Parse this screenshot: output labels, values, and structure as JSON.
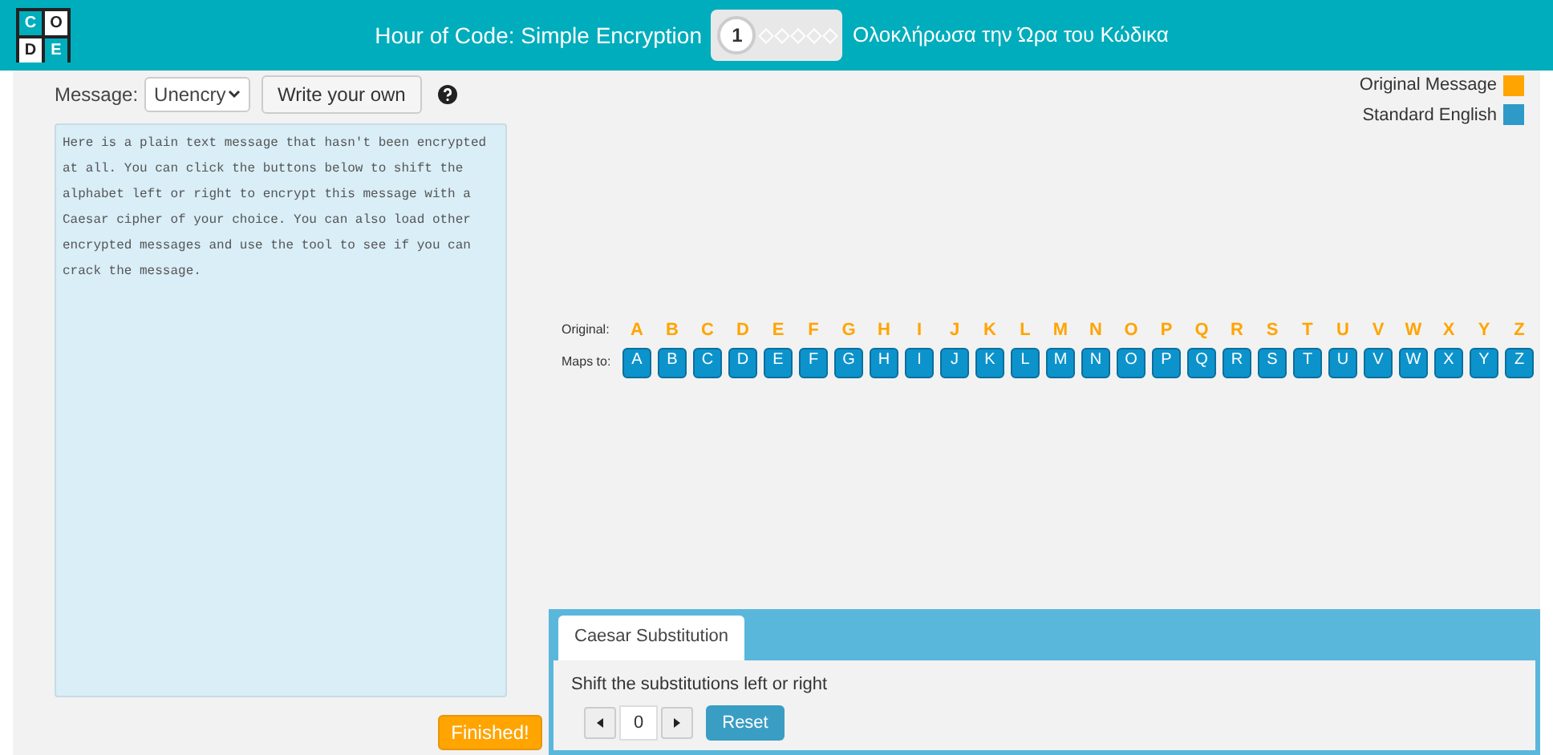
{
  "header": {
    "logo_letters": [
      "C",
      "O",
      "D",
      "E"
    ],
    "title": "Hour of Code: Simple Encryption",
    "progress": {
      "current": "1",
      "steps": [
        {
          "done": false
        },
        {
          "done": false
        },
        {
          "done": false
        },
        {
          "done": false
        },
        {
          "done": false
        }
      ]
    },
    "finish_link": "Ολοκλήρωσα την Ώρα του Κώδικα"
  },
  "message_bar": {
    "label": "Message:",
    "select_value": "Unencry",
    "write_button": "Write your own"
  },
  "message_text": "Here is a plain text message that hasn't been encrypted at all. You can click the buttons below to shift the alphabet left or right to encrypt this message with a Caesar cipher of your choice. You can also load other encrypted messages and use the tool to see if you can crack the message.",
  "finished_button": "Finished!",
  "legend": [
    {
      "label": "Original Message",
      "color": "#ffa400"
    },
    {
      "label": "Standard English",
      "color": "#2d9ac7"
    }
  ],
  "mapping": {
    "original_label": "Original:",
    "maps_label": "Maps to:",
    "original": [
      "A",
      "B",
      "C",
      "D",
      "E",
      "F",
      "G",
      "H",
      "I",
      "J",
      "K",
      "L",
      "M",
      "N",
      "O",
      "P",
      "Q",
      "R",
      "S",
      "T",
      "U",
      "V",
      "W",
      "X",
      "Y",
      "Z"
    ],
    "maps_to": [
      "A",
      "B",
      "C",
      "D",
      "E",
      "F",
      "G",
      "H",
      "I",
      "J",
      "K",
      "L",
      "M",
      "N",
      "O",
      "P",
      "Q",
      "R",
      "S",
      "T",
      "U",
      "V",
      "W",
      "X",
      "Y",
      "Z"
    ]
  },
  "panel": {
    "tabs": [
      {
        "label": "Caesar Substitution",
        "selected": true
      }
    ],
    "instruction": "Shift the substitutions left or right",
    "shift_value": "0",
    "reset_button": "Reset"
  }
}
